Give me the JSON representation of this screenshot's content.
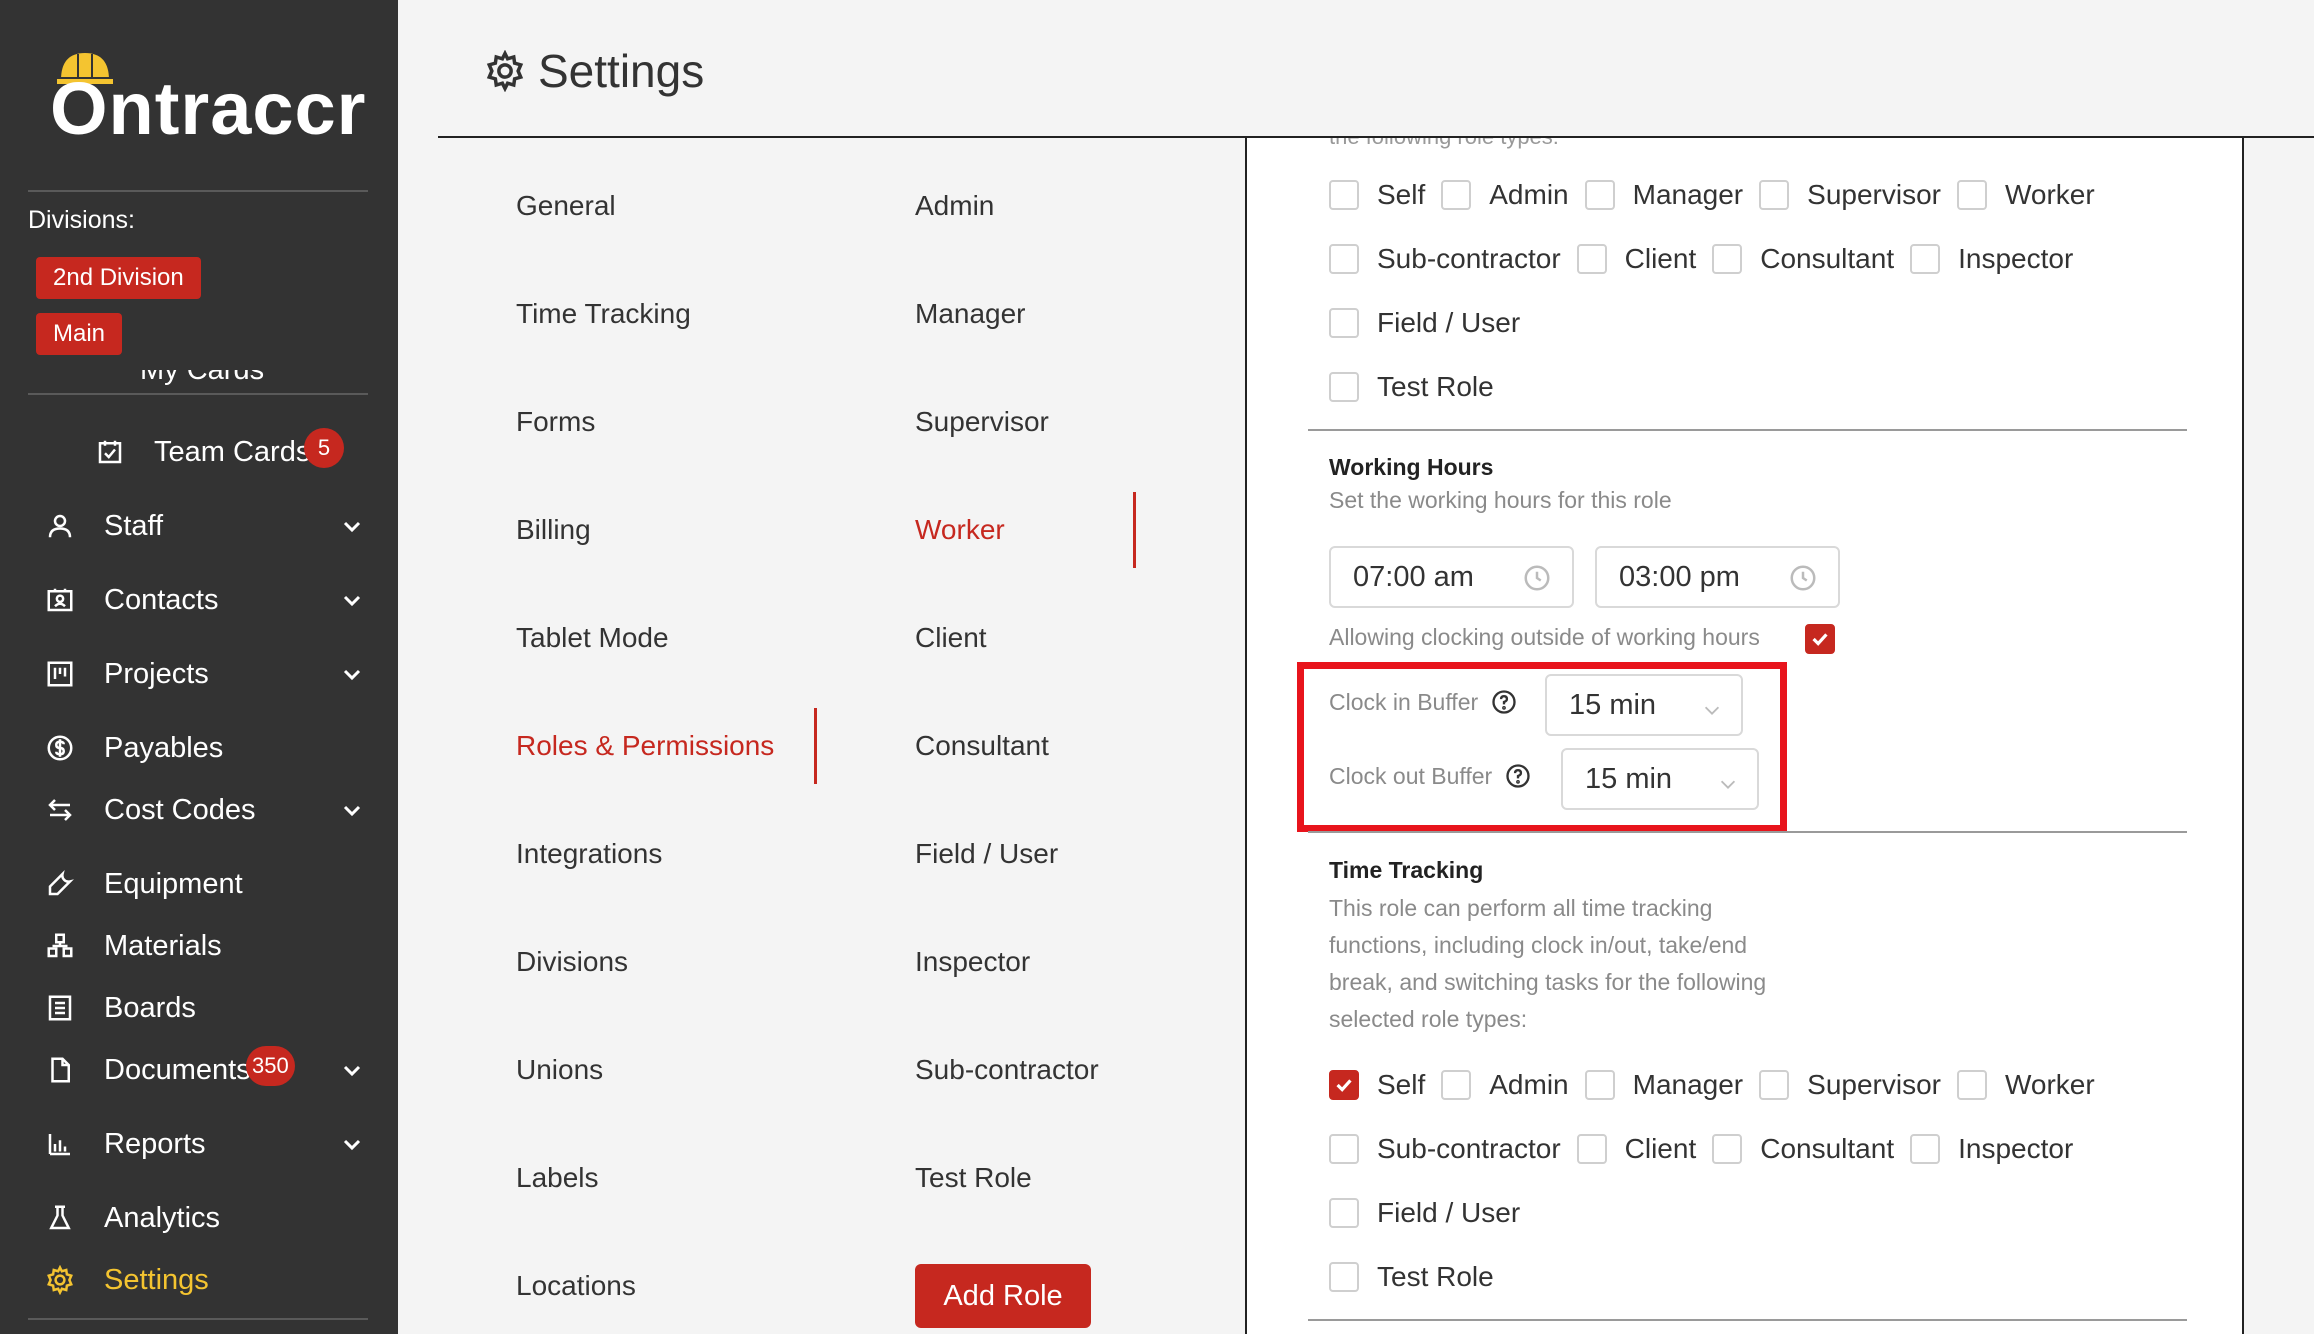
{
  "app": {
    "name": "Ontraccr"
  },
  "sidebar": {
    "divisions_label": "Divisions:",
    "divisions": [
      "2nd Division",
      "Main"
    ],
    "cut_item": "My Cards",
    "items": [
      {
        "label": "Team Cards",
        "icon": "calendar-check-icon",
        "badge": "5"
      },
      {
        "label": "Staff",
        "icon": "person-icon",
        "expandable": true
      },
      {
        "label": "Contacts",
        "icon": "contact-card-icon",
        "expandable": true
      },
      {
        "label": "Projects",
        "icon": "project-board-icon",
        "expandable": true
      },
      {
        "label": "Payables",
        "icon": "dollar-circle-icon"
      },
      {
        "label": "Cost Codes",
        "icon": "swap-arrows-icon",
        "expandable": true
      },
      {
        "label": "Equipment",
        "icon": "wrench-icon"
      },
      {
        "label": "Materials",
        "icon": "boxes-icon"
      },
      {
        "label": "Boards",
        "icon": "board-icon"
      },
      {
        "label": "Documents",
        "icon": "document-icon",
        "badge": "350",
        "expandable": true
      },
      {
        "label": "Reports",
        "icon": "bar-chart-icon",
        "expandable": true
      },
      {
        "label": "Analytics",
        "icon": "flask-icon"
      },
      {
        "label": "Settings",
        "icon": "gear-icon",
        "active": true
      }
    ]
  },
  "header": {
    "title": "Settings"
  },
  "settings_nav": {
    "items": [
      "General",
      "Time Tracking",
      "Forms",
      "Billing",
      "Tablet Mode",
      "Roles & Permissions",
      "Integrations",
      "Divisions",
      "Unions",
      "Labels",
      "Locations"
    ],
    "active": "Roles & Permissions"
  },
  "roles_nav": {
    "items": [
      "Admin",
      "Manager",
      "Supervisor",
      "Worker",
      "Client",
      "Consultant",
      "Field / User",
      "Inspector",
      "Sub-contractor",
      "Test Role"
    ],
    "active": "Worker",
    "add_role_label": "Add Role"
  },
  "panel": {
    "cut_text": "the following role types:",
    "roles_top": {
      "row1": [
        {
          "label": "Self",
          "checked": false
        },
        {
          "label": "Admin",
          "checked": false
        },
        {
          "label": "Manager",
          "checked": false
        },
        {
          "label": "Supervisor",
          "checked": false
        },
        {
          "label": "Worker",
          "checked": false
        }
      ],
      "row2": [
        {
          "label": "Sub-contractor",
          "checked": false
        },
        {
          "label": "Client",
          "checked": false
        },
        {
          "label": "Consultant",
          "checked": false
        },
        {
          "label": "Inspector",
          "checked": false
        }
      ],
      "row3": [
        {
          "label": "Field / User",
          "checked": false
        }
      ],
      "row4": [
        {
          "label": "Test Role",
          "checked": false
        }
      ]
    },
    "working_hours": {
      "title": "Working Hours",
      "desc": "Set the working hours for this role",
      "start": "07:00 am",
      "end": "03:00 pm",
      "allow_label": "Allowing clocking outside of working hours",
      "allow_checked": true,
      "clock_in_label": "Clock in Buffer",
      "clock_in_value": "15 min",
      "clock_out_label": "Clock out Buffer",
      "clock_out_value": "15 min"
    },
    "time_tracking": {
      "title": "Time Tracking",
      "desc": "This role can perform all time tracking functions, including clock in/out, take/end break, and switching tasks for the following selected role types:",
      "row1": [
        {
          "label": "Self",
          "checked": true
        },
        {
          "label": "Admin",
          "checked": false
        },
        {
          "label": "Manager",
          "checked": false
        },
        {
          "label": "Supervisor",
          "checked": false
        },
        {
          "label": "Worker",
          "checked": false
        }
      ],
      "row2": [
        {
          "label": "Sub-contractor",
          "checked": false
        },
        {
          "label": "Client",
          "checked": false
        },
        {
          "label": "Consultant",
          "checked": false
        },
        {
          "label": "Inspector",
          "checked": false
        }
      ],
      "row3": [
        {
          "label": "Field / User",
          "checked": false
        }
      ],
      "row4": [
        {
          "label": "Test Role",
          "checked": false
        }
      ]
    }
  },
  "colors": {
    "accent": "#c6281f",
    "sidebar_bg": "#333333",
    "active_nav": "#f4c430",
    "highlight": "#e8141c"
  }
}
